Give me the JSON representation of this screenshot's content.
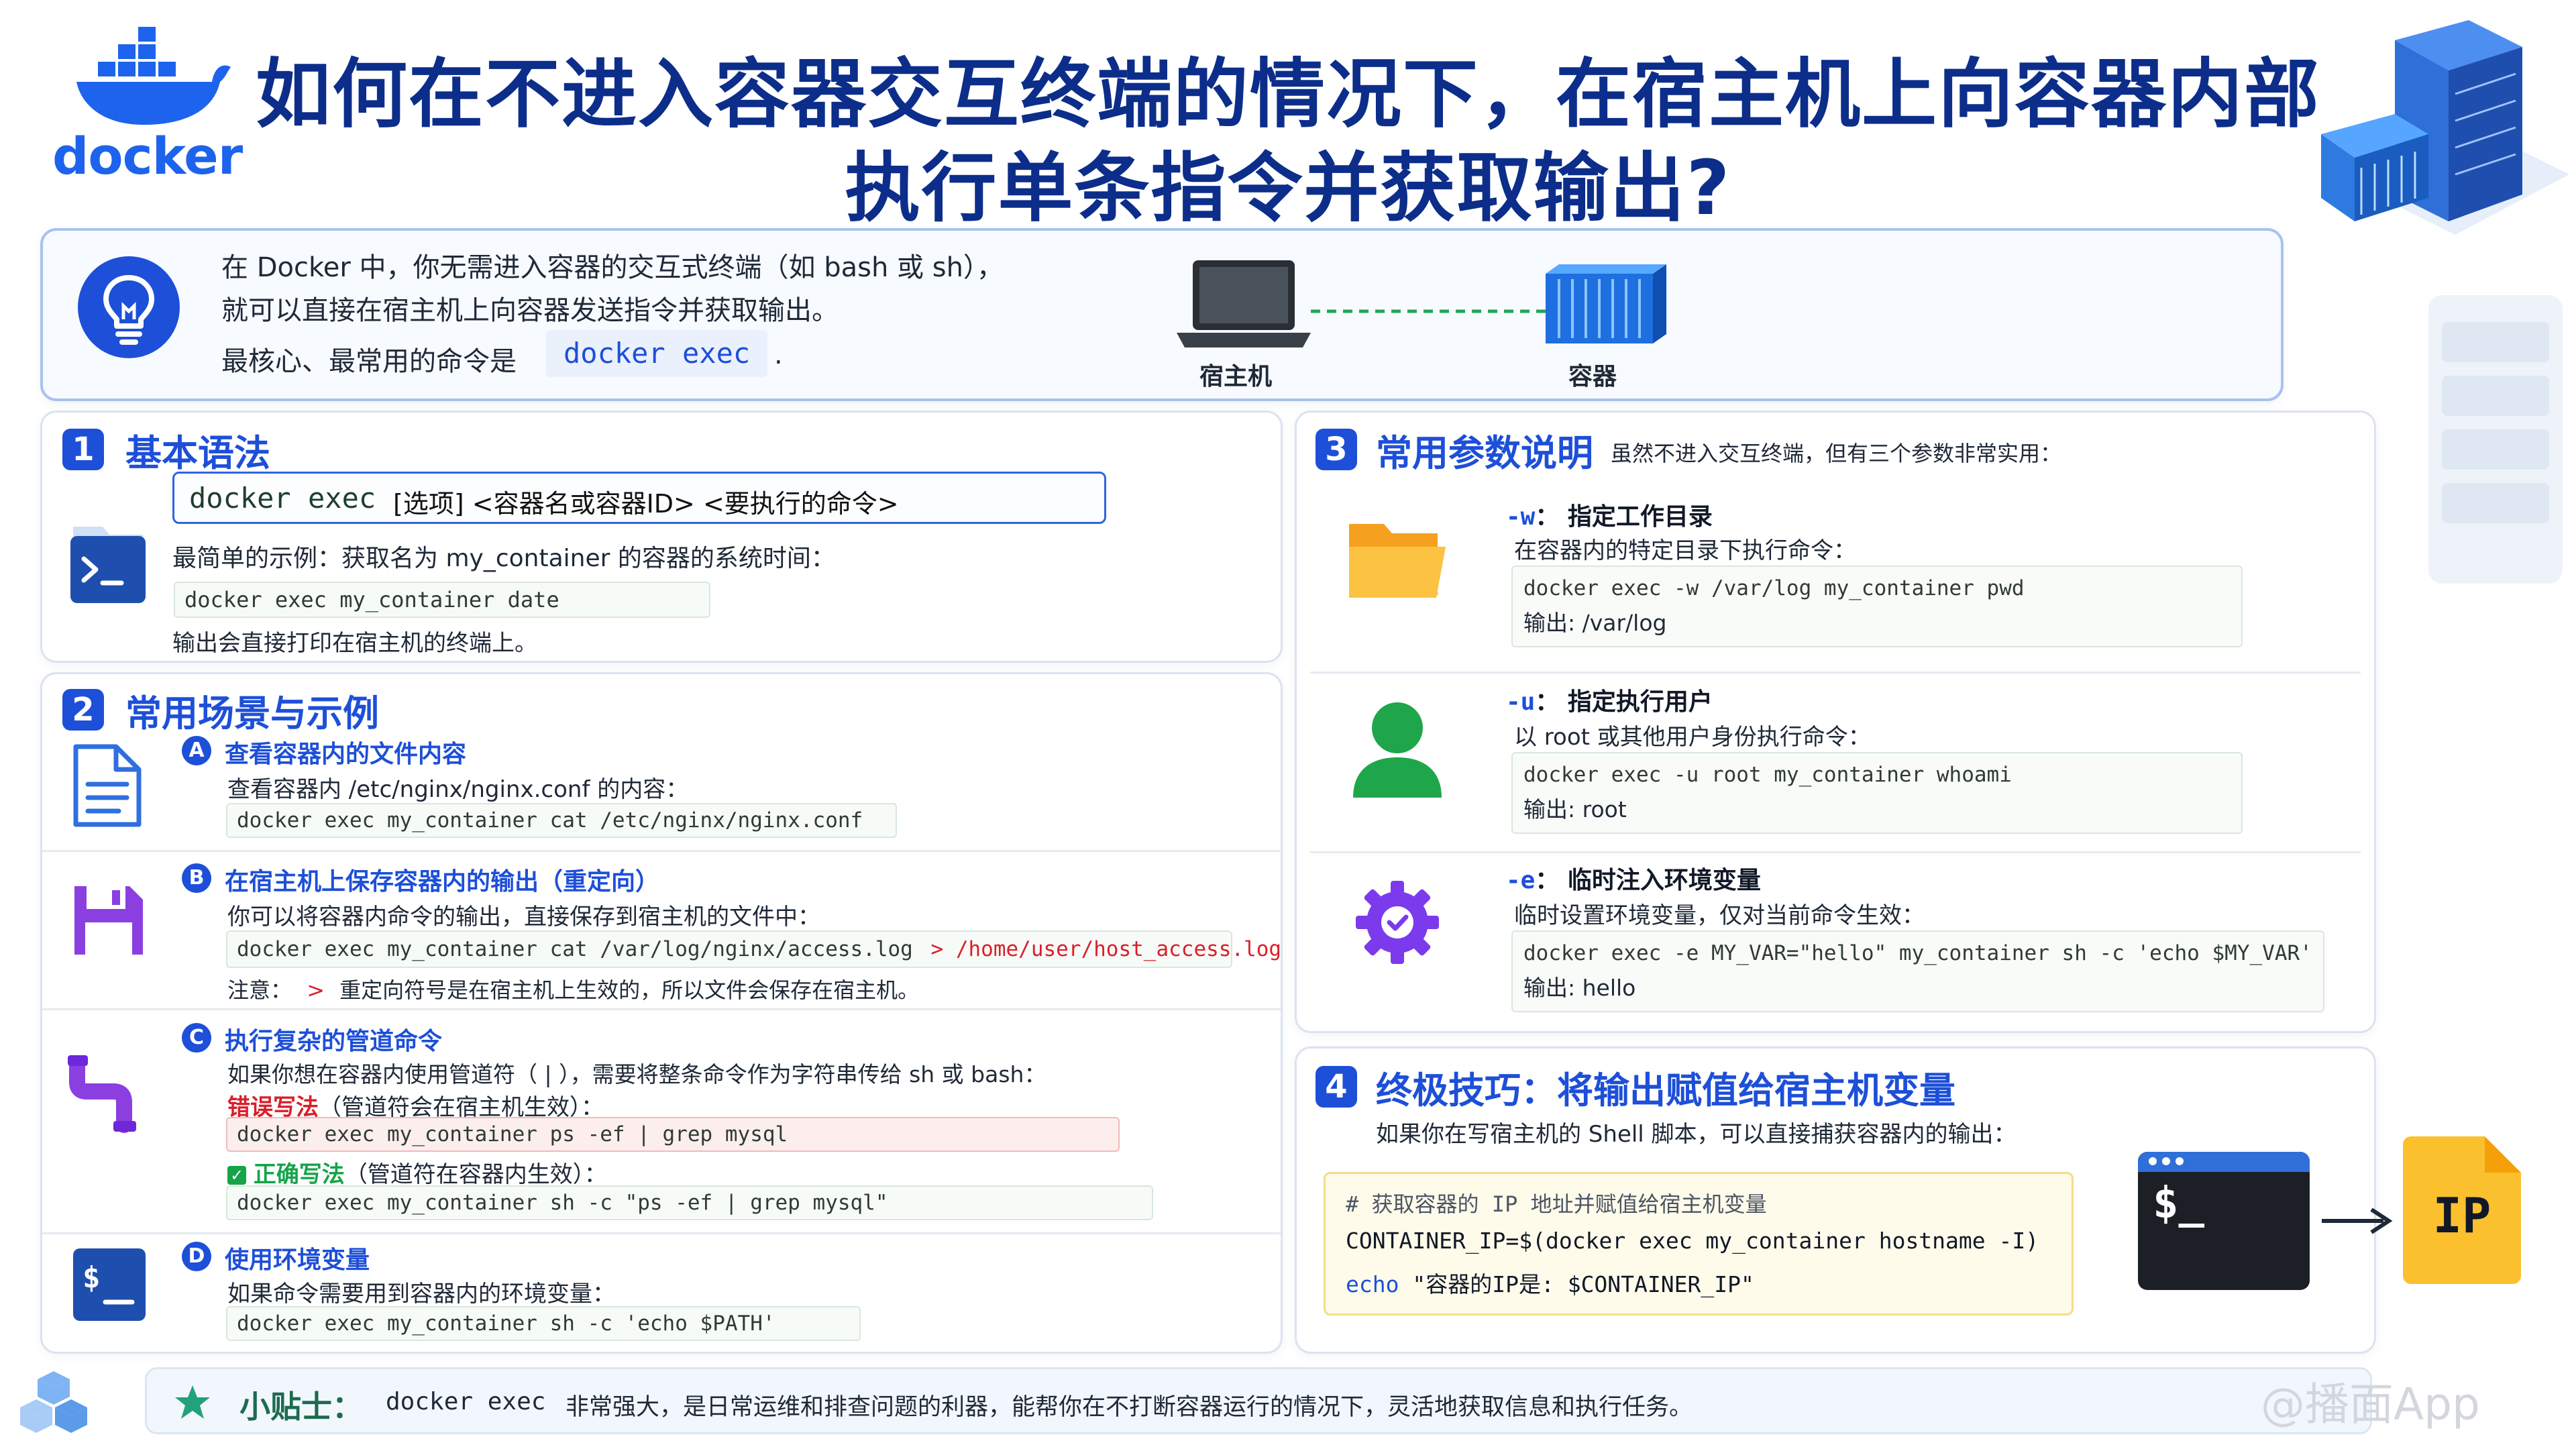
{
  "header": {
    "logo_text": "docker",
    "title_line1": "如何在不进入容器交互终端的情况下，在宿主机上向容器内部",
    "title_line2": "执行单条指令并获取输出?"
  },
  "intro": {
    "line1": "在 Docker 中，你无需进入容器的交互式终端（如 bash 或 sh），",
    "line2": "就可以直接在宿主机上向容器发送指令并获取输出。",
    "line3_prefix": "最核心、最常用的命令是",
    "line3_code": "docker exec",
    "line3_suffix": ".",
    "host_label": "宿主机",
    "container_label": "容器"
  },
  "section1": {
    "num": "1",
    "title": "基本语法",
    "syntax_code": "docker exec",
    "syntax_rest": "[选项] <容器名或容器ID> <要执行的命令>",
    "example_desc": "最简单的示例：获取名为 my_container 的容器的系统时间：",
    "example_code": "docker exec my_container date",
    "example_note": "输出会直接打印在宿主机的终端上。"
  },
  "section2": {
    "num": "2",
    "title": "常用场景与示例",
    "a": {
      "letter": "A",
      "title": "查看容器内的文件内容",
      "desc": "查看容器内 /etc/nginx/nginx.conf 的内容：",
      "code": "docker exec my_container cat /etc/nginx/nginx.conf"
    },
    "b": {
      "letter": "B",
      "title": "在宿主机上保存容器内的输出（重定向）",
      "desc": "你可以将容器内命令的输出，直接保存到宿主机的文件中：",
      "code_main": "docker exec my_container cat /var/log/nginx/access.log",
      "code_redirect": "> /home/user/host_access.log",
      "note_prefix": "注意：",
      "note_symbol": ">",
      "note_text": "重定向符号是在宿主机上生效的，所以文件会保存在宿主机。"
    },
    "c": {
      "letter": "C",
      "title": "执行复杂的管道命令",
      "desc": "如果你想在容器内使用管道符（ | ），需要将整条命令作为字符串传给 sh 或 bash：",
      "wrong_label": "错误写法",
      "wrong_note": "（管道符会在宿主机生效）：",
      "wrong_code": "docker exec my_container ps -ef | grep mysql",
      "right_label": "正确写法",
      "right_note": "（管道符在容器内生效）：",
      "right_code": "docker exec my_container sh -c \"ps -ef | grep mysql\""
    },
    "d": {
      "letter": "D",
      "title": "使用环境变量",
      "desc": "如果命令需要用到容器内的环境变量：",
      "code": "docker exec my_container sh -c 'echo $PATH'"
    }
  },
  "section3": {
    "num": "3",
    "title": "常用参数说明",
    "subtitle": "虽然不进入交互终端，但有三个参数非常实用：",
    "params": [
      {
        "flag": "-w",
        "name": "：  指定工作目录",
        "desc": "在容器内的特定目录下执行命令：",
        "code": "docker exec -w /var/log my_container pwd",
        "output": "输出: /var/log"
      },
      {
        "flag": "-u",
        "name": "：  指定执行用户",
        "desc": "以 root 或其他用户身份执行命令：",
        "code": "docker exec -u root my_container whoami",
        "output": "输出: root"
      },
      {
        "flag": "-e",
        "name": "：  临时注入环境变量",
        "desc": "临时设置环境变量，仅对当前命令生效：",
        "code": "docker exec -e MY_VAR=\"hello\" my_container sh -c 'echo $MY_VAR'",
        "output": "输出: hello"
      }
    ]
  },
  "section4": {
    "num": "4",
    "title": "终极技巧：将输出赋值给宿主机变量",
    "desc": "如果你在写宿主机的 Shell 脚本，可以直接捕获容器内的输出：",
    "code_comment": "# 获取容器的 IP 地址并赋值给宿主机变量",
    "code_line2": "CONTAINER_IP=$(docker exec my_container hostname -I)",
    "code_line3_kw": "echo",
    "code_line3_rest": "\"容器的IP是: $CONTAINER_IP\"",
    "terminal_prompt": "$_",
    "ip_label": "IP"
  },
  "tip": {
    "label": "小贴士：",
    "code": "docker exec",
    "text": "非常强大，是日常运维和排查问题的利器，能帮你在不打断容器运行的情况下，灵活地获取信息和执行任务。"
  },
  "watermark": "@播面App",
  "colors": {
    "title": "#0c2e8a",
    "accent": "#1d4fd8",
    "docker_blue": "#1d63ed",
    "error_red": "#d91f2a",
    "success_green": "#16a34a"
  }
}
